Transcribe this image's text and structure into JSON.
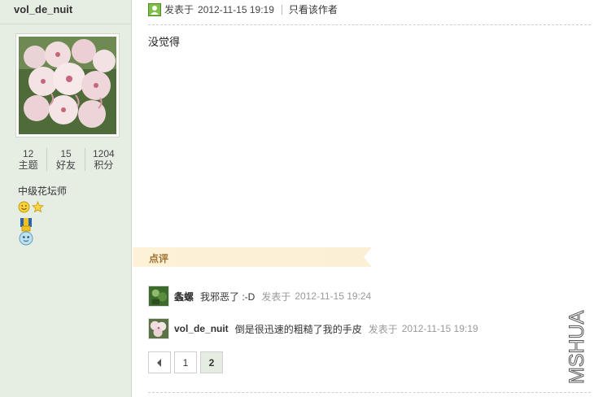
{
  "author": {
    "username": "vol_de_nuit",
    "stats": [
      {
        "value": "12",
        "label": "主题"
      },
      {
        "value": "15",
        "label": "好友"
      },
      {
        "value": "1204",
        "label": "积分"
      }
    ],
    "rank": "中级花坛师"
  },
  "post": {
    "posted_prefix": "发表于",
    "date": "2012-11-15 19:19",
    "only_author": "只看该作者",
    "content": "没觉得"
  },
  "comments_section": {
    "title": "点评",
    "items": [
      {
        "user": "螽螺",
        "text": "我邪恶了 :-D",
        "date_prefix": "发表于",
        "date": "2012-11-15 19:24"
      },
      {
        "user": "vol_de_nuit",
        "text": "倒是很迅速的粗糙了我的手皮",
        "date_prefix": "发表于",
        "date": "2012-11-15 19:19"
      }
    ]
  },
  "pagination": {
    "pages": [
      "1",
      "2"
    ],
    "current": "2"
  },
  "watermark": "MSHUA"
}
